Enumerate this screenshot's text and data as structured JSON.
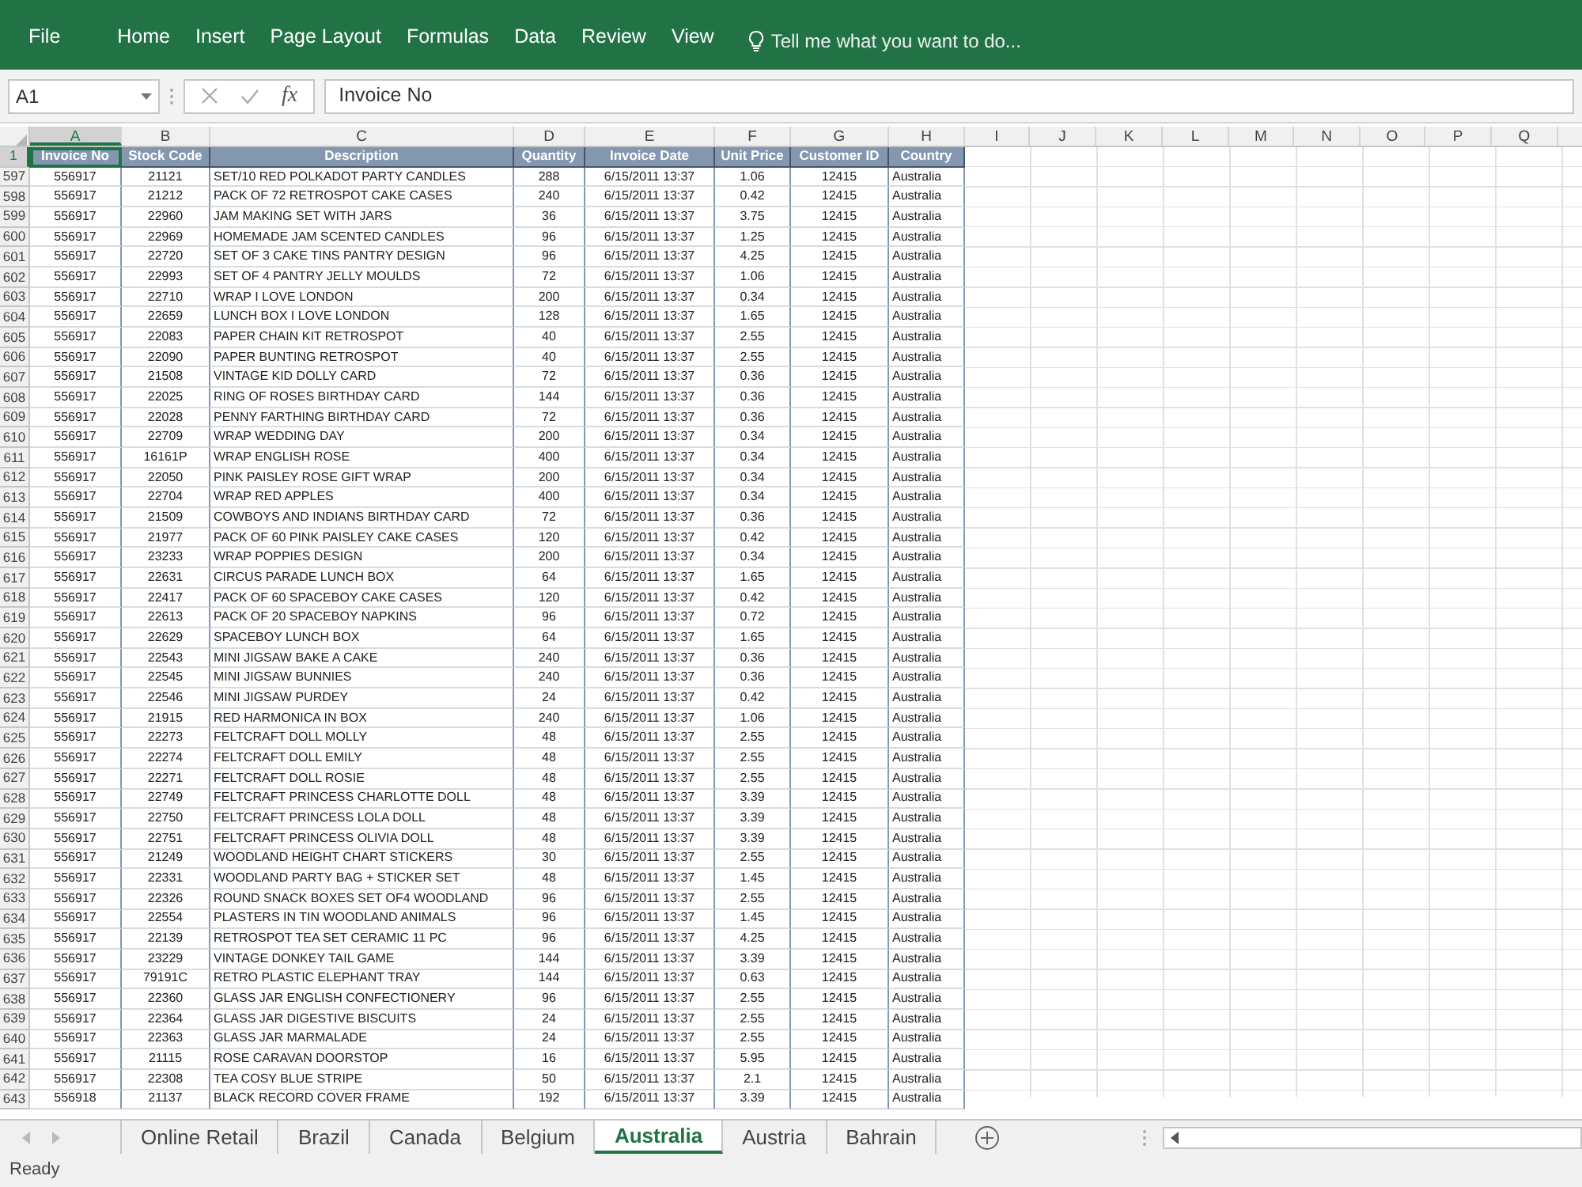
{
  "ribbon": {
    "tabs": [
      {
        "label": "File",
        "selected": false
      },
      {
        "label": "Home",
        "selected": false
      },
      {
        "label": "Insert",
        "selected": false
      },
      {
        "label": "Page Layout",
        "selected": false
      },
      {
        "label": "Formulas",
        "selected": false
      },
      {
        "label": "Data",
        "selected": false
      },
      {
        "label": "Review",
        "selected": false
      },
      {
        "label": "View",
        "selected": false
      }
    ],
    "tell_me": "Tell me what you want to do..."
  },
  "formula_bar": {
    "name_box": "A1",
    "fx": "fx",
    "formula": "Invoice No"
  },
  "columns": [
    {
      "label": "A",
      "selected": true
    },
    {
      "label": "B",
      "selected": false
    },
    {
      "label": "C",
      "selected": false
    },
    {
      "label": "D",
      "selected": false
    },
    {
      "label": "E",
      "selected": false
    },
    {
      "label": "F",
      "selected": false
    },
    {
      "label": "G",
      "selected": false
    },
    {
      "label": "H",
      "selected": false
    },
    {
      "label": "I",
      "selected": false
    },
    {
      "label": "J",
      "selected": false
    },
    {
      "label": "K",
      "selected": false
    },
    {
      "label": "L",
      "selected": false
    },
    {
      "label": "M",
      "selected": false
    },
    {
      "label": "N",
      "selected": false
    },
    {
      "label": "O",
      "selected": false
    },
    {
      "label": "P",
      "selected": false
    },
    {
      "label": "Q",
      "selected": false
    }
  ],
  "header_row": {
    "number": "1",
    "selected": true,
    "cells": [
      "Invoice No",
      "Stock Code",
      "Description",
      "Quantity",
      "Invoice Date",
      "Unit Price",
      "Customer ID",
      "Country"
    ]
  },
  "rows": [
    {
      "number": "597",
      "cells": [
        "556917",
        "21121",
        "SET/10 RED POLKADOT PARTY CANDLES",
        "288",
        "6/15/2011 13:37",
        "1.06",
        "12415",
        "Australia"
      ]
    },
    {
      "number": "598",
      "cells": [
        "556917",
        "21212",
        "PACK OF 72 RETROSPOT CAKE CASES",
        "240",
        "6/15/2011 13:37",
        "0.42",
        "12415",
        "Australia"
      ]
    },
    {
      "number": "599",
      "cells": [
        "556917",
        "22960",
        "JAM MAKING SET WITH JARS",
        "36",
        "6/15/2011 13:37",
        "3.75",
        "12415",
        "Australia"
      ]
    },
    {
      "number": "600",
      "cells": [
        "556917",
        "22969",
        "HOMEMADE JAM SCENTED CANDLES",
        "96",
        "6/15/2011 13:37",
        "1.25",
        "12415",
        "Australia"
      ]
    },
    {
      "number": "601",
      "cells": [
        "556917",
        "22720",
        "SET OF 3 CAKE TINS PANTRY DESIGN",
        "96",
        "6/15/2011 13:37",
        "4.25",
        "12415",
        "Australia"
      ]
    },
    {
      "number": "602",
      "cells": [
        "556917",
        "22993",
        "SET OF 4 PANTRY JELLY MOULDS",
        "72",
        "6/15/2011 13:37",
        "1.06",
        "12415",
        "Australia"
      ]
    },
    {
      "number": "603",
      "cells": [
        "556917",
        "22710",
        "WRAP I LOVE LONDON",
        "200",
        "6/15/2011 13:37",
        "0.34",
        "12415",
        "Australia"
      ]
    },
    {
      "number": "604",
      "cells": [
        "556917",
        "22659",
        "LUNCH BOX I LOVE LONDON",
        "128",
        "6/15/2011 13:37",
        "1.65",
        "12415",
        "Australia"
      ]
    },
    {
      "number": "605",
      "cells": [
        "556917",
        "22083",
        "PAPER CHAIN KIT RETROSPOT",
        "40",
        "6/15/2011 13:37",
        "2.55",
        "12415",
        "Australia"
      ]
    },
    {
      "number": "606",
      "cells": [
        "556917",
        "22090",
        "PAPER BUNTING RETROSPOT",
        "40",
        "6/15/2011 13:37",
        "2.55",
        "12415",
        "Australia"
      ]
    },
    {
      "number": "607",
      "cells": [
        "556917",
        "21508",
        "VINTAGE KID DOLLY CARD",
        "72",
        "6/15/2011 13:37",
        "0.36",
        "12415",
        "Australia"
      ]
    },
    {
      "number": "608",
      "cells": [
        "556917",
        "22025",
        "RING OF ROSES BIRTHDAY CARD",
        "144",
        "6/15/2011 13:37",
        "0.36",
        "12415",
        "Australia"
      ]
    },
    {
      "number": "609",
      "cells": [
        "556917",
        "22028",
        "PENNY FARTHING BIRTHDAY CARD",
        "72",
        "6/15/2011 13:37",
        "0.36",
        "12415",
        "Australia"
      ]
    },
    {
      "number": "610",
      "cells": [
        "556917",
        "22709",
        "WRAP WEDDING DAY",
        "200",
        "6/15/2011 13:37",
        "0.34",
        "12415",
        "Australia"
      ]
    },
    {
      "number": "611",
      "cells": [
        "556917",
        "16161P",
        "WRAP ENGLISH ROSE",
        "400",
        "6/15/2011 13:37",
        "0.34",
        "12415",
        "Australia"
      ]
    },
    {
      "number": "612",
      "cells": [
        "556917",
        "22050",
        "PINK PAISLEY ROSE GIFT WRAP",
        "200",
        "6/15/2011 13:37",
        "0.34",
        "12415",
        "Australia"
      ]
    },
    {
      "number": "613",
      "cells": [
        "556917",
        "22704",
        "WRAP RED APPLES",
        "400",
        "6/15/2011 13:37",
        "0.34",
        "12415",
        "Australia"
      ]
    },
    {
      "number": "614",
      "cells": [
        "556917",
        "21509",
        "COWBOYS AND INDIANS BIRTHDAY CARD",
        "72",
        "6/15/2011 13:37",
        "0.36",
        "12415",
        "Australia"
      ]
    },
    {
      "number": "615",
      "cells": [
        "556917",
        "21977",
        "PACK OF 60 PINK PAISLEY CAKE CASES",
        "120",
        "6/15/2011 13:37",
        "0.42",
        "12415",
        "Australia"
      ]
    },
    {
      "number": "616",
      "cells": [
        "556917",
        "23233",
        "WRAP POPPIES  DESIGN",
        "200",
        "6/15/2011 13:37",
        "0.34",
        "12415",
        "Australia"
      ]
    },
    {
      "number": "617",
      "cells": [
        "556917",
        "22631",
        "CIRCUS PARADE LUNCH BOX",
        "64",
        "6/15/2011 13:37",
        "1.65",
        "12415",
        "Australia"
      ]
    },
    {
      "number": "618",
      "cells": [
        "556917",
        "22417",
        "PACK OF 60 SPACEBOY CAKE CASES",
        "120",
        "6/15/2011 13:37",
        "0.42",
        "12415",
        "Australia"
      ]
    },
    {
      "number": "619",
      "cells": [
        "556917",
        "22613",
        "PACK OF 20 SPACEBOY NAPKINS",
        "96",
        "6/15/2011 13:37",
        "0.72",
        "12415",
        "Australia"
      ]
    },
    {
      "number": "620",
      "cells": [
        "556917",
        "22629",
        "SPACEBOY LUNCH BOX",
        "64",
        "6/15/2011 13:37",
        "1.65",
        "12415",
        "Australia"
      ]
    },
    {
      "number": "621",
      "cells": [
        "556917",
        "22543",
        "MINI JIGSAW BAKE A CAKE",
        "240",
        "6/15/2011 13:37",
        "0.36",
        "12415",
        "Australia"
      ]
    },
    {
      "number": "622",
      "cells": [
        "556917",
        "22545",
        "MINI JIGSAW BUNNIES",
        "240",
        "6/15/2011 13:37",
        "0.36",
        "12415",
        "Australia"
      ]
    },
    {
      "number": "623",
      "cells": [
        "556917",
        "22546",
        "MINI JIGSAW PURDEY",
        "24",
        "6/15/2011 13:37",
        "0.42",
        "12415",
        "Australia"
      ]
    },
    {
      "number": "624",
      "cells": [
        "556917",
        "21915",
        "RED  HARMONICA IN BOX",
        "240",
        "6/15/2011 13:37",
        "1.06",
        "12415",
        "Australia"
      ]
    },
    {
      "number": "625",
      "cells": [
        "556917",
        "22273",
        "FELTCRAFT DOLL MOLLY",
        "48",
        "6/15/2011 13:37",
        "2.55",
        "12415",
        "Australia"
      ]
    },
    {
      "number": "626",
      "cells": [
        "556917",
        "22274",
        "FELTCRAFT DOLL EMILY",
        "48",
        "6/15/2011 13:37",
        "2.55",
        "12415",
        "Australia"
      ]
    },
    {
      "number": "627",
      "cells": [
        "556917",
        "22271",
        "FELTCRAFT DOLL ROSIE",
        "48",
        "6/15/2011 13:37",
        "2.55",
        "12415",
        "Australia"
      ]
    },
    {
      "number": "628",
      "cells": [
        "556917",
        "22749",
        "FELTCRAFT PRINCESS CHARLOTTE DOLL",
        "48",
        "6/15/2011 13:37",
        "3.39",
        "12415",
        "Australia"
      ]
    },
    {
      "number": "629",
      "cells": [
        "556917",
        "22750",
        "FELTCRAFT PRINCESS LOLA DOLL",
        "48",
        "6/15/2011 13:37",
        "3.39",
        "12415",
        "Australia"
      ]
    },
    {
      "number": "630",
      "cells": [
        "556917",
        "22751",
        "FELTCRAFT PRINCESS OLIVIA DOLL",
        "48",
        "6/15/2011 13:37",
        "3.39",
        "12415",
        "Australia"
      ]
    },
    {
      "number": "631",
      "cells": [
        "556917",
        "21249",
        "WOODLAND  HEIGHT CHART STICKERS",
        "30",
        "6/15/2011 13:37",
        "2.55",
        "12415",
        "Australia"
      ]
    },
    {
      "number": "632",
      "cells": [
        "556917",
        "22331",
        "WOODLAND PARTY BAG + STICKER SET",
        "48",
        "6/15/2011 13:37",
        "1.45",
        "12415",
        "Australia"
      ]
    },
    {
      "number": "633",
      "cells": [
        "556917",
        "22326",
        "ROUND SNACK BOXES SET OF4 WOODLAND",
        "96",
        "6/15/2011 13:37",
        "2.55",
        "12415",
        "Australia"
      ]
    },
    {
      "number": "634",
      "cells": [
        "556917",
        "22554",
        "PLASTERS IN TIN WOODLAND ANIMALS",
        "96",
        "6/15/2011 13:37",
        "1.45",
        "12415",
        "Australia"
      ]
    },
    {
      "number": "635",
      "cells": [
        "556917",
        "22139",
        "RETROSPOT TEA SET CERAMIC 11 PC",
        "96",
        "6/15/2011 13:37",
        "4.25",
        "12415",
        "Australia"
      ]
    },
    {
      "number": "636",
      "cells": [
        "556917",
        "23229",
        "VINTAGE DONKEY TAIL GAME",
        "144",
        "6/15/2011 13:37",
        "3.39",
        "12415",
        "Australia"
      ]
    },
    {
      "number": "637",
      "cells": [
        "556917",
        "79191C",
        "RETRO PLASTIC ELEPHANT TRAY",
        "144",
        "6/15/2011 13:37",
        "0.63",
        "12415",
        "Australia"
      ]
    },
    {
      "number": "638",
      "cells": [
        "556917",
        "22360",
        "GLASS JAR ENGLISH CONFECTIONERY",
        "96",
        "6/15/2011 13:37",
        "2.55",
        "12415",
        "Australia"
      ]
    },
    {
      "number": "639",
      "cells": [
        "556917",
        "22364",
        "GLASS JAR DIGESTIVE BISCUITS",
        "24",
        "6/15/2011 13:37",
        "2.55",
        "12415",
        "Australia"
      ]
    },
    {
      "number": "640",
      "cells": [
        "556917",
        "22363",
        "GLASS JAR MARMALADE",
        "24",
        "6/15/2011 13:37",
        "2.55",
        "12415",
        "Australia"
      ]
    },
    {
      "number": "641",
      "cells": [
        "556917",
        "21115",
        "ROSE CARAVAN DOORSTOP",
        "16",
        "6/15/2011 13:37",
        "5.95",
        "12415",
        "Australia"
      ]
    },
    {
      "number": "642",
      "cells": [
        "556917",
        "22308",
        "TEA COSY BLUE STRIPE",
        "50",
        "6/15/2011 13:37",
        "2.1",
        "12415",
        "Australia"
      ]
    },
    {
      "number": "643",
      "cells": [
        "556918",
        "21137",
        "BLACK RECORD COVER FRAME",
        "192",
        "6/15/2011 13:37",
        "3.39",
        "12415",
        "Australia"
      ]
    }
  ],
  "sheet_tabs": [
    {
      "label": "Online Retail",
      "selected": false
    },
    {
      "label": "Brazil",
      "selected": false
    },
    {
      "label": "Canada",
      "selected": false
    },
    {
      "label": "Belgium",
      "selected": false
    },
    {
      "label": "Australia",
      "selected": true
    },
    {
      "label": "Austria",
      "selected": false
    },
    {
      "label": "Bahrain",
      "selected": false
    }
  ],
  "status_bar": {
    "text": "Ready"
  }
}
